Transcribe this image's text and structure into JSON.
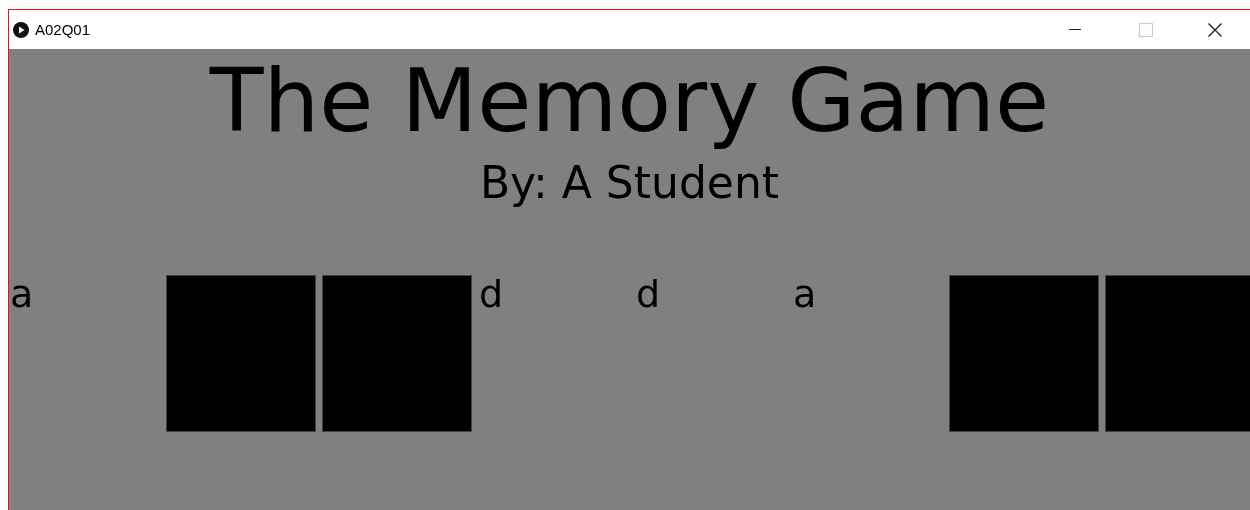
{
  "window": {
    "title": "A02Q01"
  },
  "heading": "The Memory Game",
  "byline": "By: A Student",
  "cards": [
    {
      "face_up": true,
      "letter": "a"
    },
    {
      "face_up": false
    },
    {
      "face_up": false
    },
    {
      "face_up": true,
      "letter": "d"
    },
    {
      "face_up": true,
      "letter": "d"
    },
    {
      "face_up": true,
      "letter": "a"
    },
    {
      "face_up": false
    },
    {
      "face_up": false
    }
  ]
}
